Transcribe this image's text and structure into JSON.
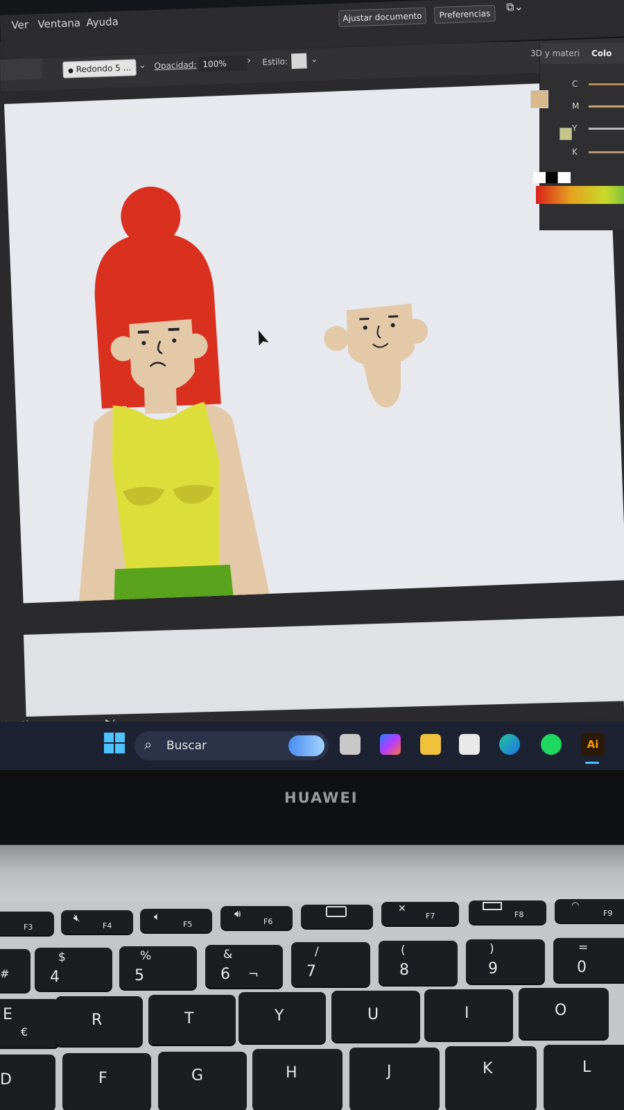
{
  "menu": {
    "ver": "Ver",
    "ventana": "Ventana",
    "ayuda": "Ayuda"
  },
  "control_bar": {
    "brush_name": "Redondo 5 ...",
    "opacity_label": "Opacidad:",
    "opacity_value": "100%",
    "style_label": "Estilo:",
    "fit_document": "Ajustar documento",
    "preferences": "Preferencias"
  },
  "panel": {
    "tab_3d": "3D y materi",
    "tab_color": "Colo",
    "channels": [
      "C",
      "M",
      "Y",
      "K"
    ]
  },
  "status": {
    "selection": "elección"
  },
  "taskbar": {
    "search_label": "Buscar",
    "ai_label": "Ai"
  },
  "laptop": {
    "brand": "HUAWEI"
  },
  "keyboard": {
    "fn_row": [
      {
        "label": "F3"
      },
      {
        "label": "F4",
        "icon": "mute-icon"
      },
      {
        "label": "F5",
        "icon": "volume-down-icon"
      },
      {
        "label": "F6",
        "icon": "volume-up-icon"
      },
      {
        "label": "",
        "icon": "camera-icon"
      },
      {
        "label": "F7",
        "icon": "mic-off-icon"
      },
      {
        "label": "F8",
        "icon": "project-icon"
      },
      {
        "label": "F9",
        "icon": "wifi-icon"
      }
    ],
    "number_row": [
      {
        "top": "",
        "main": "#"
      },
      {
        "top": "$",
        "main": "4"
      },
      {
        "top": "%",
        "main": "5"
      },
      {
        "top": "&",
        "main": "6",
        "alt": "¬"
      },
      {
        "top": "/",
        "main": "7"
      },
      {
        "top": "(",
        "main": "8"
      },
      {
        "top": ")",
        "main": "9"
      },
      {
        "top": "=",
        "main": "0"
      }
    ],
    "top_row": [
      {
        "main": "E",
        "alt": "€"
      },
      {
        "main": "R"
      },
      {
        "main": "T"
      },
      {
        "main": "Y"
      },
      {
        "main": "U"
      },
      {
        "main": "I"
      },
      {
        "main": "O"
      }
    ],
    "home_row": [
      {
        "main": "D"
      },
      {
        "main": "F"
      },
      {
        "main": "G"
      },
      {
        "main": "H"
      },
      {
        "main": "J"
      },
      {
        "main": "K"
      },
      {
        "main": "L"
      }
    ]
  },
  "colors": {
    "hair": "#d9301f",
    "skin": "#e3c9a8",
    "top": "#dede3a",
    "skirt": "#5aa31c",
    "artboard": "#e7e9ee",
    "taskbar": "#1d2233"
  }
}
